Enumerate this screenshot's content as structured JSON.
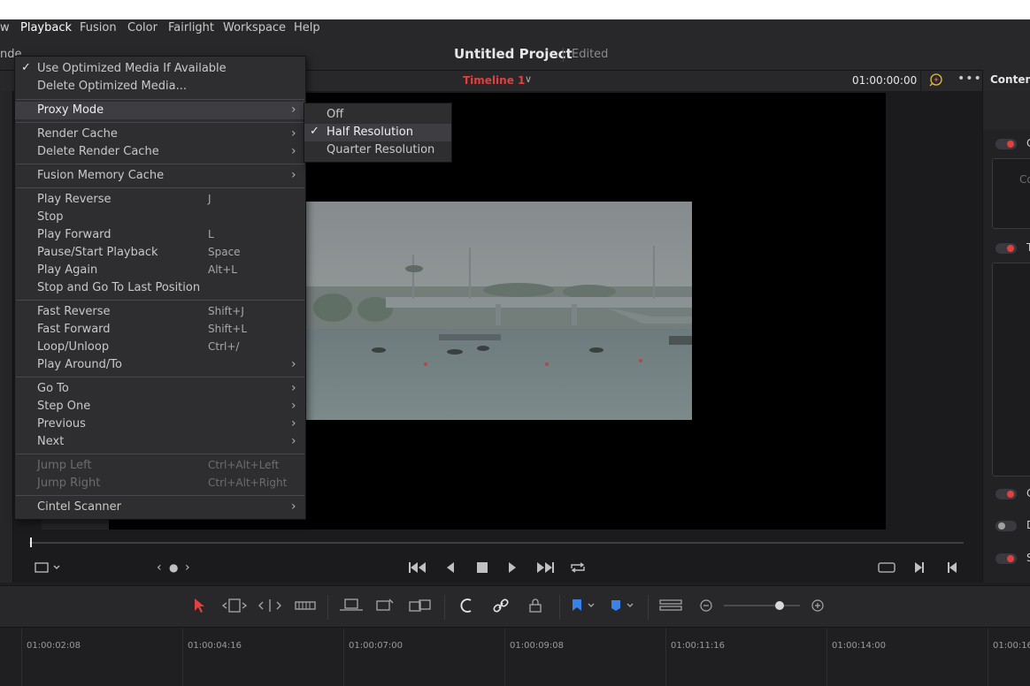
{
  "menubar": {
    "items": [
      "w",
      "Playback",
      "Fusion",
      "Color",
      "Fairlight",
      "Workspace",
      "Help"
    ],
    "active": "Playback"
  },
  "left_clipped_label": "nde",
  "project": {
    "title": "Untitled Project",
    "status": "Edited"
  },
  "viewer": {
    "timeline_name": "Timeline 1",
    "timecode": "01:00:00:00",
    "fx_icon": "sparkle-icon",
    "more_icon": "more-dots-icon",
    "playback_progress": 0.0
  },
  "right_panel": {
    "title": "Content",
    "rows": [
      {
        "toggle": "on",
        "letter": "C"
      },
      {
        "placeholder": "Co"
      },
      {
        "toggle": "on",
        "letter": "T"
      },
      {
        "toggle": "on",
        "letter": "C"
      },
      {
        "toggle": "off",
        "letter": "D"
      },
      {
        "toggle": "on",
        "letter": "S"
      }
    ]
  },
  "transport": {
    "icons": [
      "viewer-mode-icon",
      "prev-clip-icon",
      "jog-dot-icon",
      "next-clip-icon",
      "jump-start-icon",
      "play-reverse-icon",
      "stop-icon",
      "play-icon",
      "jump-end-icon",
      "loop-icon",
      "match-frame-icon",
      "next-edit-icon",
      "prev-edit-icon"
    ]
  },
  "edit_toolbar": {
    "icons": [
      "selection-arrow-icon",
      "trim-edit-icon",
      "dynamic-trim-icon",
      "blade-icon",
      "insert-clip-icon",
      "overwrite-clip-icon",
      "replace-clip-icon",
      "snapping-icon",
      "linked-selection-icon",
      "position-lock-icon",
      "flag-icon",
      "marker-icon",
      "timeline-view-icon",
      "zoom-out-icon",
      "zoom-in-icon"
    ],
    "zoom_level": 0.73
  },
  "ruler": {
    "labels": [
      "01:00:02:08",
      "01:00:04:16",
      "01:00:07:00",
      "01:00:09:08",
      "01:00:11:16",
      "01:00:14:00",
      "01:00:16"
    ]
  },
  "playback_menu": {
    "items": [
      {
        "label": "Use Optimized Media If Available",
        "checked": true
      },
      {
        "label": "Delete Optimized Media..."
      },
      {
        "label": "Proxy Mode",
        "submenu": true,
        "highlighted": true
      },
      {
        "label": "Render Cache",
        "submenu": true
      },
      {
        "label": "Delete Render Cache",
        "submenu": true
      },
      {
        "label": "Fusion Memory Cache",
        "submenu": true
      },
      {
        "label": "Play Reverse",
        "shortcut": "J"
      },
      {
        "label": "Stop"
      },
      {
        "label": "Play Forward",
        "shortcut": "L"
      },
      {
        "label": "Pause/Start Playback",
        "shortcut": "Space"
      },
      {
        "label": "Play Again",
        "shortcut": "Alt+L"
      },
      {
        "label": "Stop and Go To Last Position"
      },
      {
        "label": "Fast Reverse",
        "shortcut": "Shift+J"
      },
      {
        "label": "Fast Forward",
        "shortcut": "Shift+L"
      },
      {
        "label": "Loop/Unloop",
        "shortcut": "Ctrl+/"
      },
      {
        "label": "Play Around/To",
        "submenu": true
      },
      {
        "label": "Go To",
        "submenu": true
      },
      {
        "label": "Step One",
        "submenu": true
      },
      {
        "label": "Previous",
        "submenu": true
      },
      {
        "label": "Next",
        "submenu": true
      },
      {
        "label": "Jump Left",
        "shortcut": "Ctrl+Alt+Left",
        "disabled": true
      },
      {
        "label": "Jump Right",
        "shortcut": "Ctrl+Alt+Right",
        "disabled": true
      },
      {
        "label": "Cintel Scanner",
        "submenu": true
      }
    ]
  },
  "proxy_submenu": {
    "items": [
      {
        "label": "Off"
      },
      {
        "label": "Half Resolution",
        "checked": true
      },
      {
        "label": "Quarter Resolution"
      }
    ]
  }
}
